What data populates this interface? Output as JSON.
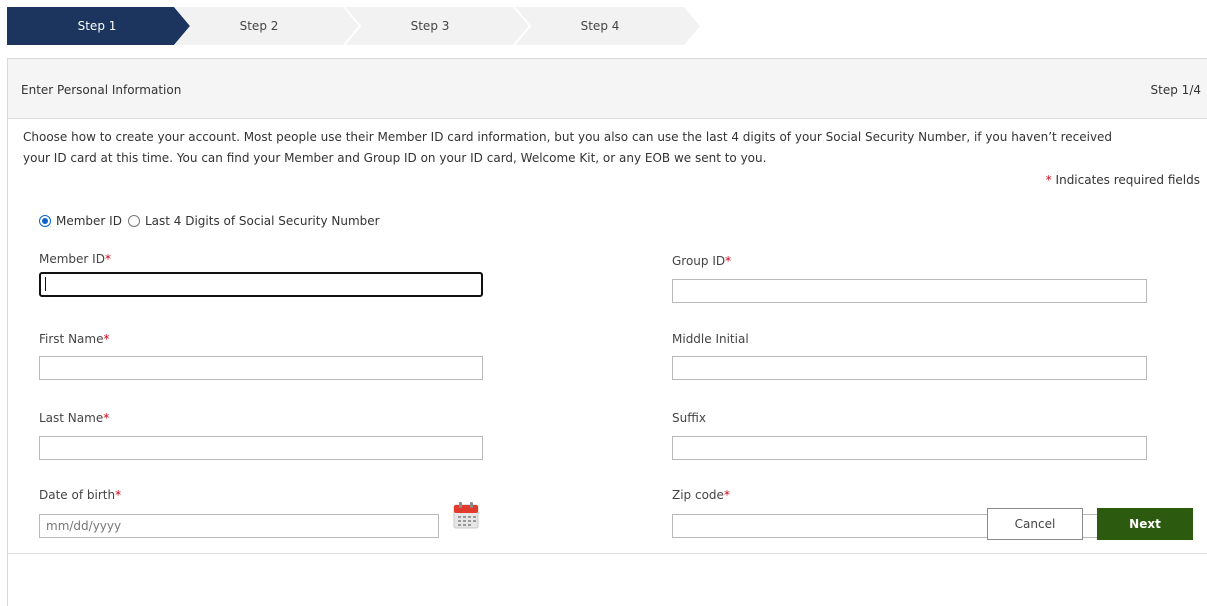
{
  "stepper": {
    "steps": [
      {
        "label": "Step 1",
        "active": true
      },
      {
        "label": "Step 2",
        "active": false
      },
      {
        "label": "Step 3",
        "active": false
      },
      {
        "label": "Step 4",
        "active": false
      }
    ],
    "colors": {
      "active": "#1b355e",
      "inactive": "#f2f2f2",
      "separator": "#ffffff"
    }
  },
  "panel": {
    "title": "Enter Personal Information",
    "step_indicator": "Step 1/4",
    "intro_line1": "Choose how to create your account. Most people use their Member ID card information, but you also can use the last 4 digits of your Social Security Number, if you haven’t received",
    "intro_line2": "your ID card at this time. You can find your Member and Group ID on your ID card, Welcome Kit, or any EOB we sent to you.",
    "required_note_star": "*",
    "required_note_text": " Indicates required fields"
  },
  "id_choice": {
    "options": [
      "Member ID",
      "Last 4 Digits of Social Security Number"
    ],
    "selected": "Member ID"
  },
  "fields": {
    "member_id": {
      "label": "Member ID",
      "required": "*",
      "value": ""
    },
    "group_id": {
      "label": "Group ID",
      "required": "*",
      "value": ""
    },
    "first_name": {
      "label": "First Name",
      "required": "*",
      "value": ""
    },
    "middle_initial": {
      "label": "Middle Initial",
      "value": ""
    },
    "last_name": {
      "label": "Last Name",
      "required": "*",
      "value": ""
    },
    "suffix": {
      "label": "Suffix",
      "value": ""
    },
    "dob": {
      "label": "Date of birth",
      "required": "*",
      "placeholder": "mm/dd/yyyy"
    },
    "zip": {
      "label": "Zip code",
      "required": "*",
      "value": ""
    }
  },
  "icons": {
    "calendar": "calendar-icon"
  },
  "actions": {
    "cancel": "Cancel",
    "next": "Next",
    "next_color": "#2c5b0f"
  }
}
